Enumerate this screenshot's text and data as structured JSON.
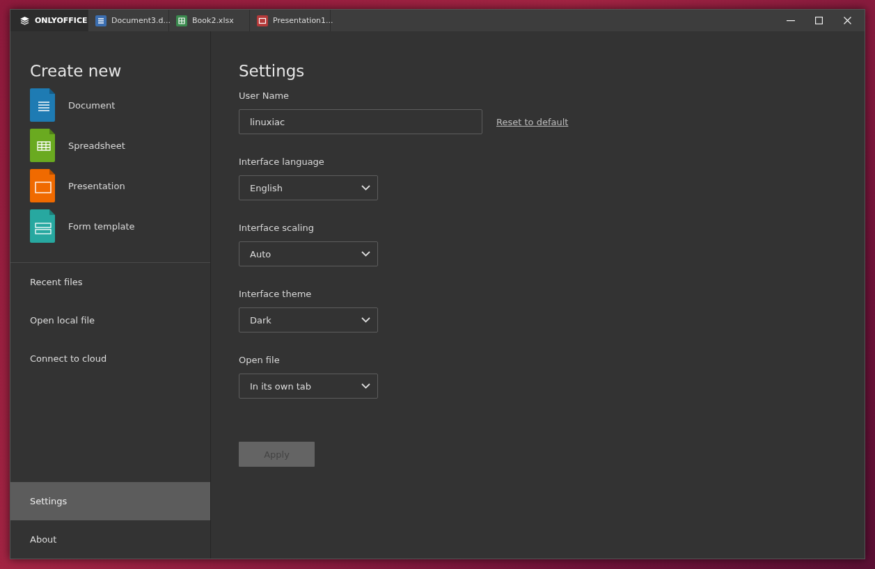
{
  "tabs": [
    {
      "kind": "home",
      "label": "ONLYOFFICE",
      "selected": true
    },
    {
      "kind": "document",
      "label": "Document3.d...",
      "selected": false
    },
    {
      "kind": "spreadsheet",
      "label": "Book2.xlsx",
      "selected": false
    },
    {
      "kind": "presentation",
      "label": "Presentation1...",
      "selected": false
    }
  ],
  "create_new": {
    "title": "Create new",
    "items": [
      {
        "kind": "document",
        "label": "Document"
      },
      {
        "kind": "spreadsheet",
        "label": "Spreadsheet"
      },
      {
        "kind": "presentation",
        "label": "Presentation"
      },
      {
        "kind": "form",
        "label": "Form template"
      }
    ]
  },
  "nav_top": [
    {
      "label": "Recent files",
      "selected": false
    },
    {
      "label": "Open local file",
      "selected": false
    },
    {
      "label": "Connect to cloud",
      "selected": false
    }
  ],
  "nav_bottom": [
    {
      "label": "Settings",
      "selected": true
    },
    {
      "label": "About",
      "selected": false
    }
  ],
  "settings": {
    "title": "Settings",
    "fields": [
      {
        "kind": "text",
        "label": "User Name",
        "value": "linuxiac",
        "link": "Reset to default"
      },
      {
        "kind": "select",
        "label": "Interface language",
        "value": "English"
      },
      {
        "kind": "select",
        "label": "Interface scaling",
        "value": "Auto"
      },
      {
        "kind": "select",
        "label": "Interface theme",
        "value": "Dark"
      },
      {
        "kind": "select",
        "label": "Open file",
        "value": "In its own tab"
      }
    ],
    "apply": {
      "label": "Apply",
      "disabled": true
    }
  }
}
